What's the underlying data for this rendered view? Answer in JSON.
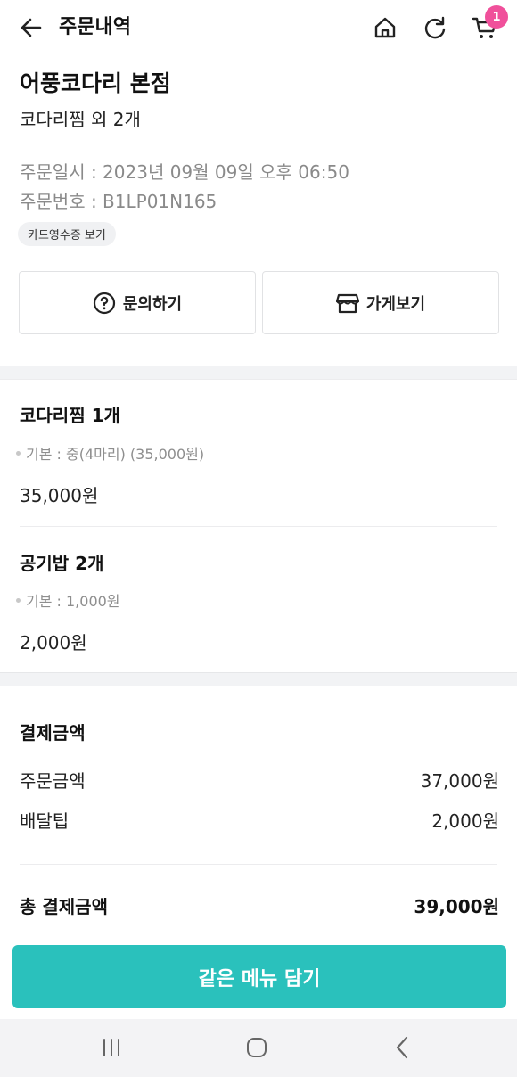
{
  "header": {
    "title": "주문내역",
    "cart_badge": "1"
  },
  "order": {
    "store_name": "어풍코다리 본점",
    "summary": "코다리찜 외 2개",
    "date_label": "주문일시 : 2023년 09월 09일 오후 06:50",
    "number_label": "주문번호 : B1LP01N165",
    "receipt_button": "카드영수증 보기"
  },
  "actions": {
    "inquiry": "문의하기",
    "view_store": "가게보기"
  },
  "items": [
    {
      "name": "코다리찜 1개",
      "option": "기본 : 중(4마리) (35,000원)",
      "price": "35,000원"
    },
    {
      "name": "공기밥 2개",
      "option": "기본 : 1,000원",
      "price": "2,000원"
    }
  ],
  "payment": {
    "title": "결제금액",
    "order_amount_label": "주문금액",
    "order_amount": "37,000원",
    "delivery_tip_label": "배달팁",
    "delivery_tip": "2,000원",
    "total_label": "총 결제금액",
    "total": "39,000원"
  },
  "cta_label": "같은 메뉴 담기",
  "colors": {
    "accent": "#2ac1bc",
    "badge": "#f0509b"
  },
  "icons": [
    "back-arrow-icon",
    "home-icon",
    "refresh-icon",
    "cart-icon",
    "question-circle-icon",
    "store-icon",
    "recent-apps-icon",
    "home-nav-icon",
    "back-nav-icon"
  ]
}
